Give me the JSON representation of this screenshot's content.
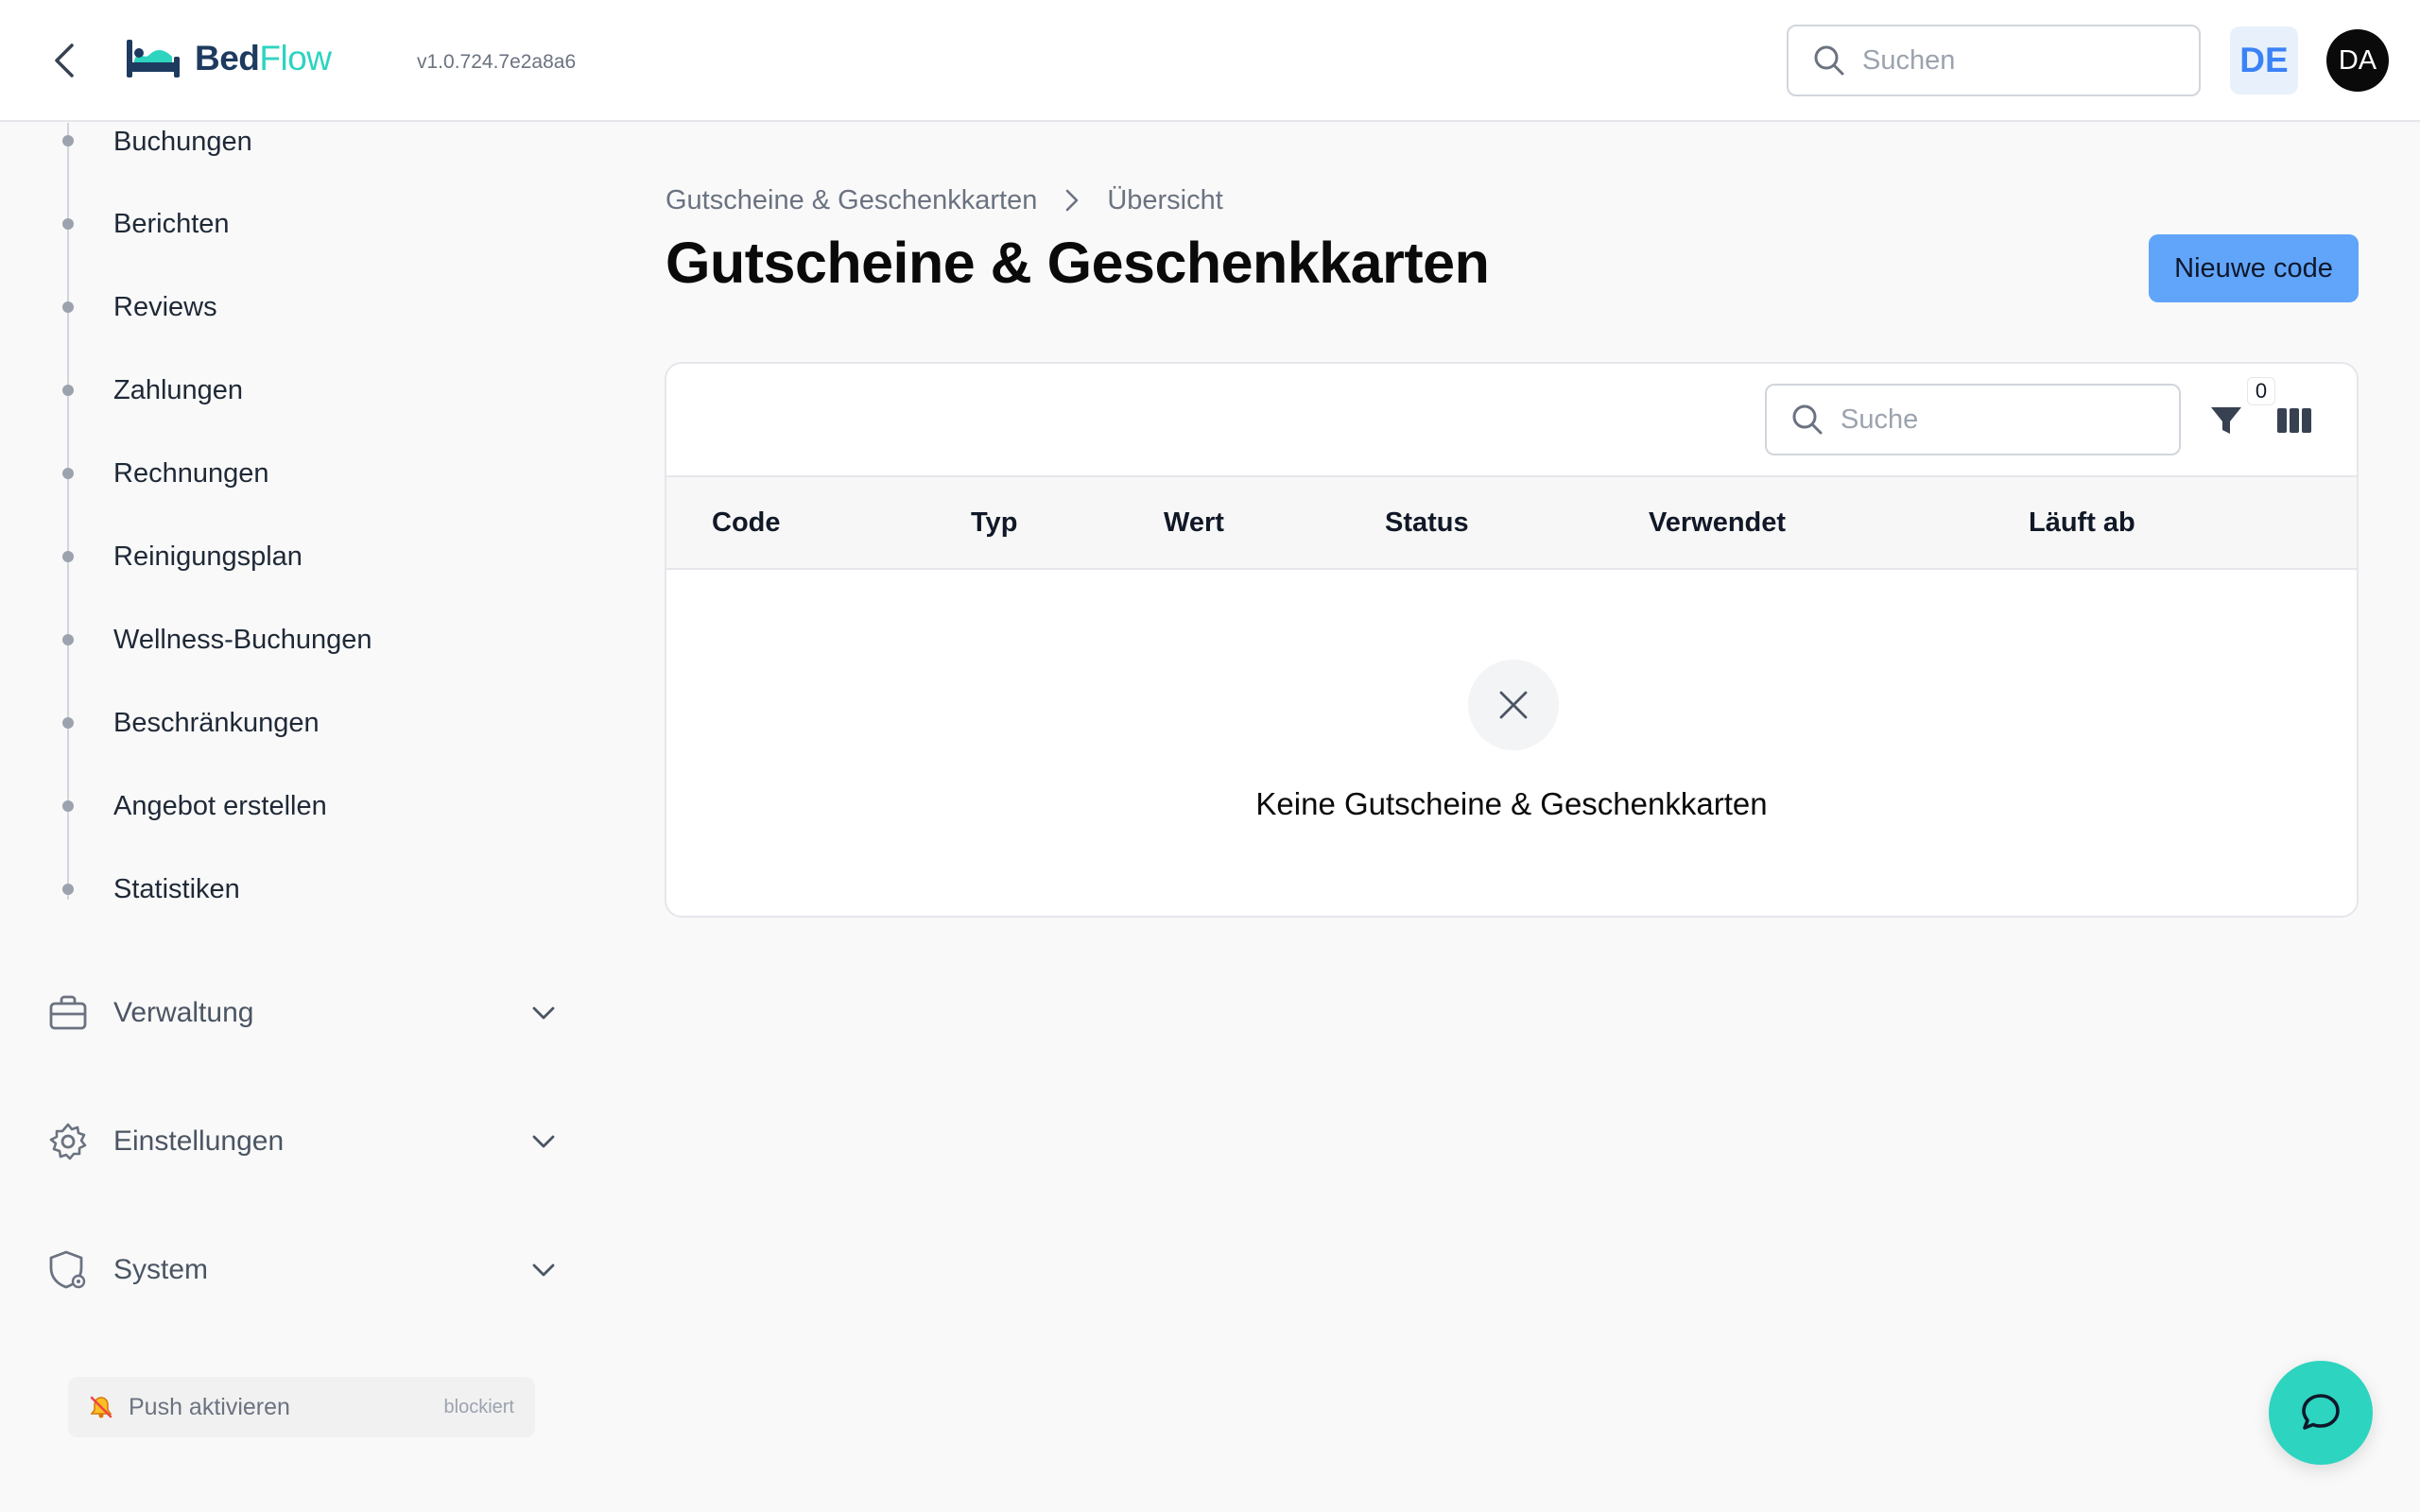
{
  "header": {
    "logo_bed": "Bed",
    "logo_flow": "Flow",
    "version": "v1.0.724.7e2a8a6",
    "search_placeholder": "Suchen",
    "language": "DE",
    "avatar_initials": "DA"
  },
  "sidebar": {
    "sub_items": [
      "Buchungen",
      "Berichten",
      "Reviews",
      "Zahlungen",
      "Rechnungen",
      "Reinigungsplan",
      "Wellness-Buchungen",
      "Beschränkungen",
      "Angebot erstellen",
      "Statistiken"
    ],
    "sections": [
      {
        "label": "Verwaltung",
        "icon": "briefcase-icon"
      },
      {
        "label": "Einstellungen",
        "icon": "gear-icon"
      },
      {
        "label": "System",
        "icon": "shield-gear-icon"
      }
    ],
    "push": {
      "label": "Push aktivieren",
      "status": "blockiert",
      "icon": "bell-off-icon"
    }
  },
  "main": {
    "breadcrumb": [
      "Gutscheine & Geschenkkarten",
      "Übersicht"
    ],
    "title": "Gutscheine & Geschenkkarten",
    "new_button": "Nieuwe code",
    "table": {
      "search_placeholder": "Suche",
      "filter_count": "0",
      "columns": [
        "Code",
        "Typ",
        "Wert",
        "Status",
        "Verwendet",
        "Läuft ab"
      ],
      "empty_message": "Keine Gutscheine & Geschenkkarten"
    }
  },
  "colors": {
    "accent": "#60a5fa",
    "brand_teal": "#2dd4bf",
    "brand_navy": "#1e3a5f"
  }
}
